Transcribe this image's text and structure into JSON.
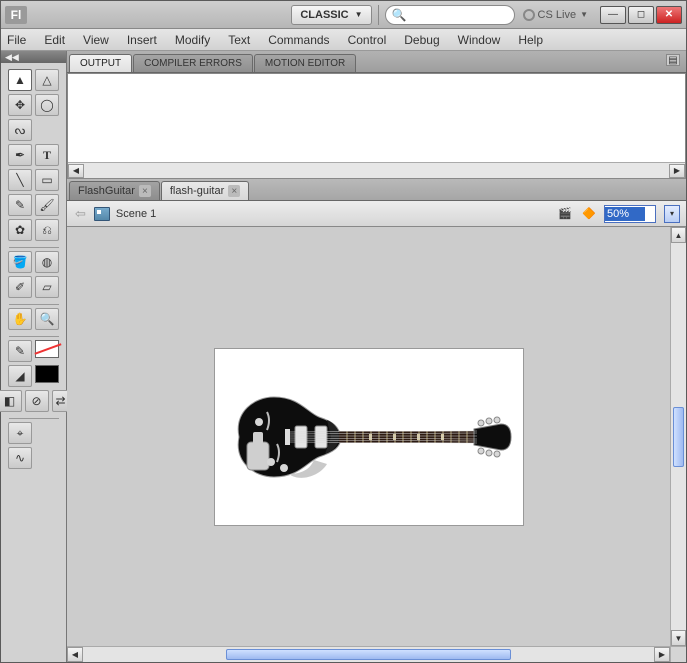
{
  "title": {
    "logo": "Fl",
    "workspace": "CLASSIC",
    "cslive": "CS Live"
  },
  "search": {
    "placeholder": ""
  },
  "menu": {
    "file": "File",
    "edit": "Edit",
    "view": "View",
    "insert": "Insert",
    "modify": "Modify",
    "text": "Text",
    "commands": "Commands",
    "control": "Control",
    "debug": "Debug",
    "window": "Window",
    "help": "Help"
  },
  "panels": {
    "output": "OUTPUT",
    "compiler": "COMPILER ERRORS",
    "motion": "MOTION EDITOR"
  },
  "docs": {
    "tab1": "FlashGuitar",
    "tab2": "flash-guitar"
  },
  "editbar": {
    "scene": "Scene 1",
    "zoom": "50%"
  },
  "tools_desc": {
    "selection": "Selection",
    "subsel": "Subselection",
    "freetrans": "Free Transform",
    "gradtrans": "3D Rotation",
    "lasso": "Lasso",
    "pen": "Pen",
    "text": "Text",
    "line": "Line",
    "rect": "Rectangle",
    "pencil": "Pencil",
    "brush": "Brush",
    "deco": "Deco",
    "bone": "Bone",
    "paint": "Paint Bucket",
    "ink": "Ink Bottle",
    "eye": "Eyedropper",
    "eraser": "Eraser",
    "hand": "Hand",
    "zoom": "Zoom",
    "stroke": "Stroke Color",
    "fill": "Fill Color",
    "bw": "Black and White",
    "swap": "Swap Colors",
    "snap": "Snap",
    "smooth": "Smooth"
  }
}
